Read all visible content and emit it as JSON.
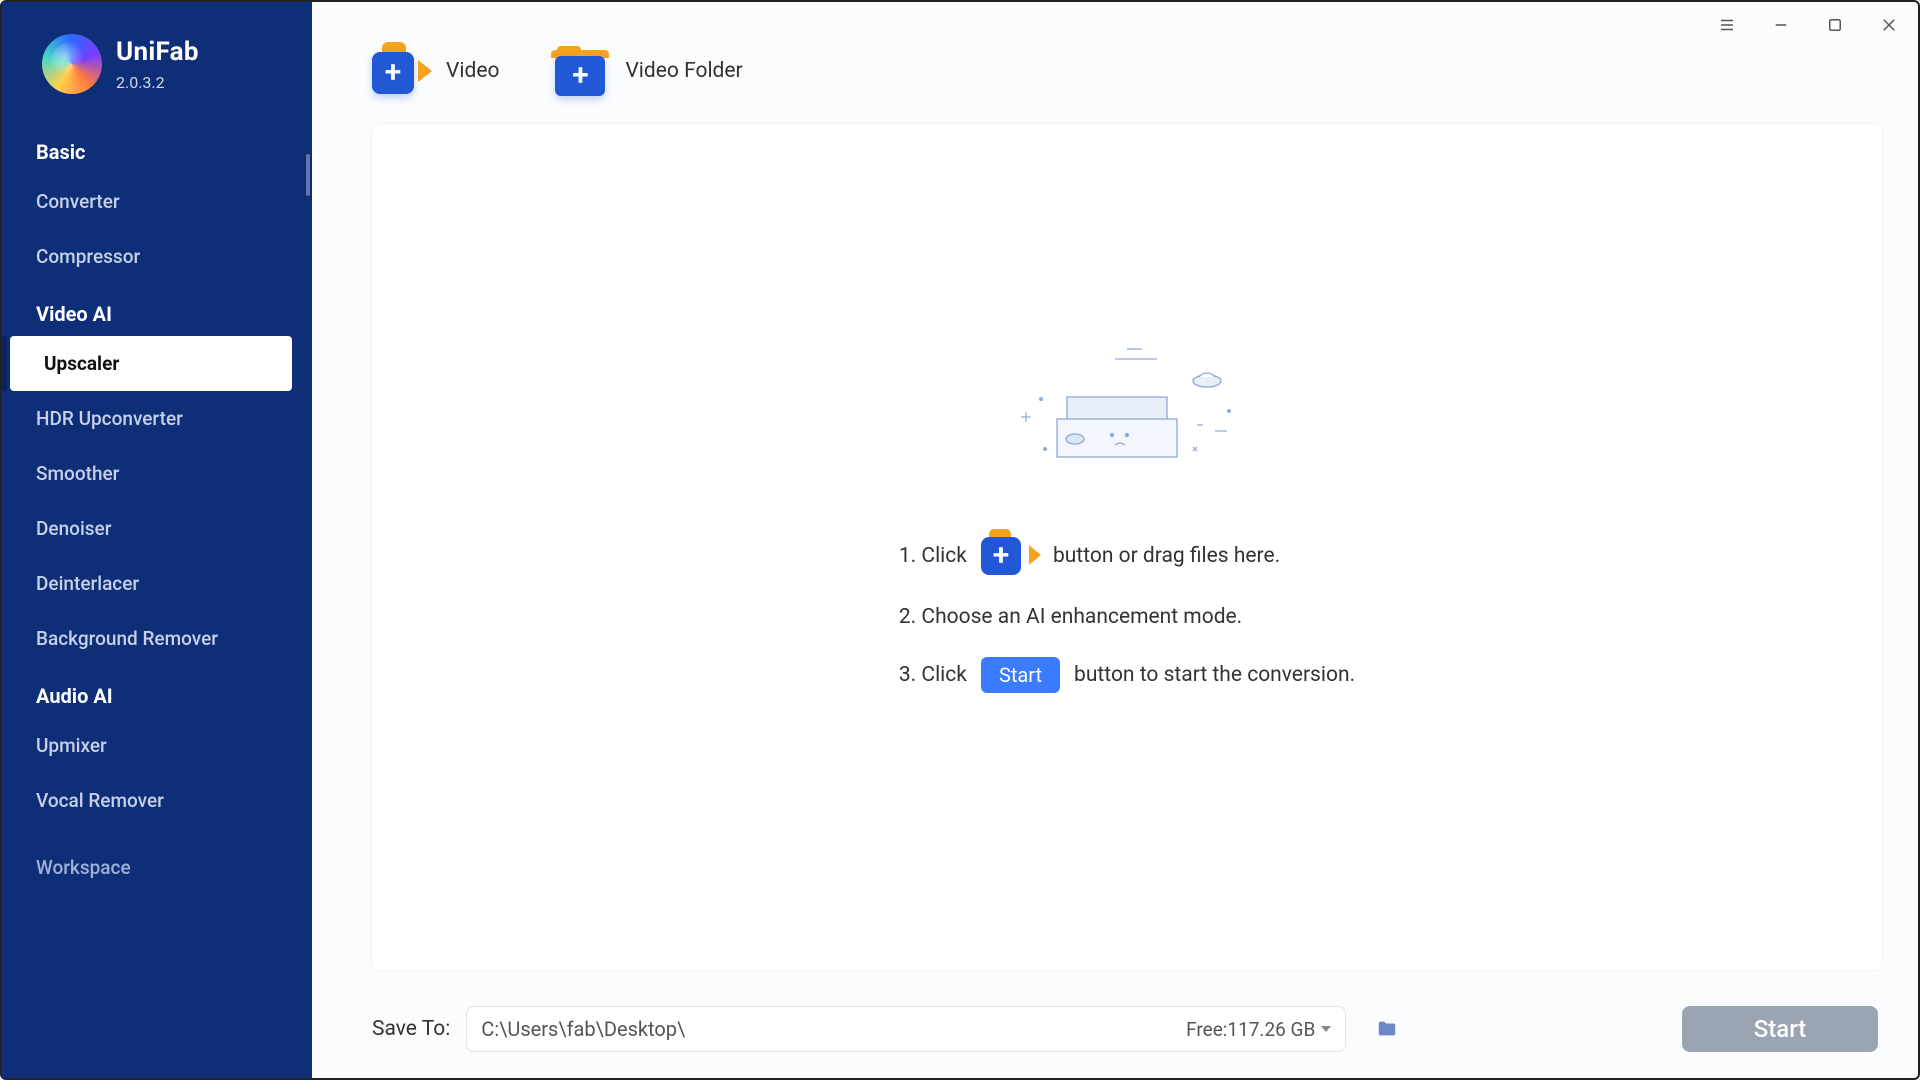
{
  "brand": {
    "name": "UniFab",
    "version": "2.0.3.2"
  },
  "sidebar": {
    "groups": [
      {
        "title": "Basic",
        "items": [
          "Converter",
          "Compressor"
        ]
      },
      {
        "title": "Video AI",
        "items": [
          "Upscaler",
          "HDR Upconverter",
          "Smoother",
          "Denoiser",
          "Deinterlacer",
          "Background Remover"
        ]
      },
      {
        "title": "Audio AI",
        "items": [
          "Upmixer",
          "Vocal Remover"
        ]
      }
    ],
    "truncated": "Workspace",
    "active": "Upscaler"
  },
  "toolbar": {
    "add_video_label": "Video",
    "add_folder_label": "Video Folder"
  },
  "steps": {
    "s1a": "1. Click",
    "s1b": "button or drag files here.",
    "s2": "2. Choose an AI enhancement mode.",
    "s3a": "3. Click",
    "s3b": "button to start the conversion.",
    "start_small": "Start"
  },
  "bottom": {
    "save_to": "Save To:",
    "path": "C:\\Users\\fab\\Desktop\\",
    "free": "Free:117.26 GB",
    "start": "Start"
  }
}
